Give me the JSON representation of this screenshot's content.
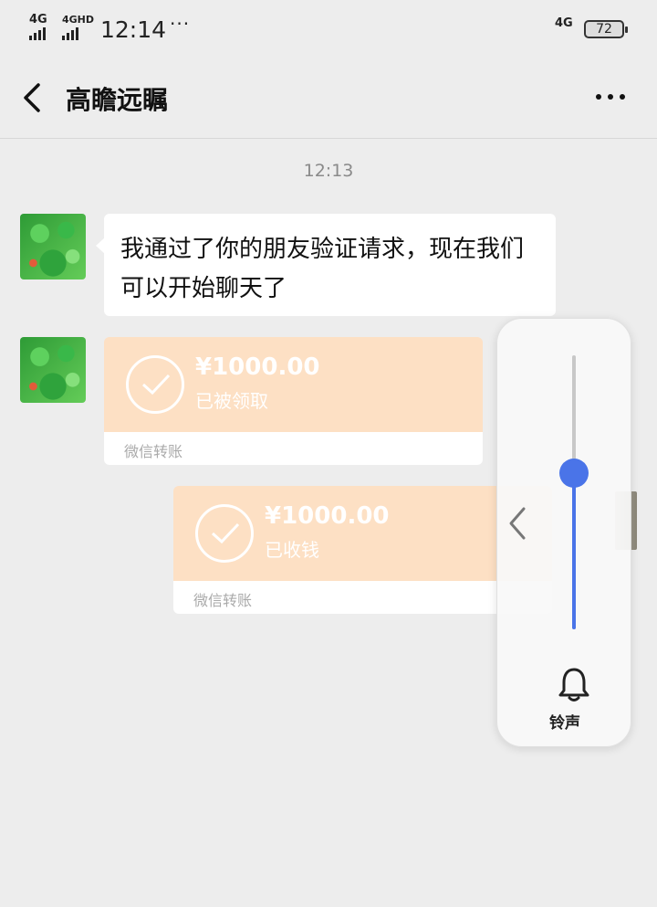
{
  "status_bar": {
    "network_left_1": "4G",
    "network_left_2": "4GHD",
    "time": "12:14",
    "more_indicator": "···",
    "network_right": "4G",
    "battery": "72"
  },
  "header": {
    "title": "高瞻远瞩",
    "back_icon": "chevron-left-icon",
    "menu_icon": "more-horizontal-icon"
  },
  "chat": {
    "timestamp": "12:13",
    "message_text": "我通过了你的朋友验证请求，现在我们可以开始聊天了",
    "transfer_received": {
      "amount": "¥1000.00",
      "status": "已被领取",
      "label": "微信转账"
    },
    "transfer_sent": {
      "amount": "¥1000.00",
      "status": "已收钱",
      "label": "微信转账"
    }
  },
  "volume_panel": {
    "level": 0.57,
    "ring_label": "铃声",
    "accent_color": "#4a74e8"
  },
  "colors": {
    "background": "#ededed",
    "transfer_card": "#fde0c4"
  }
}
